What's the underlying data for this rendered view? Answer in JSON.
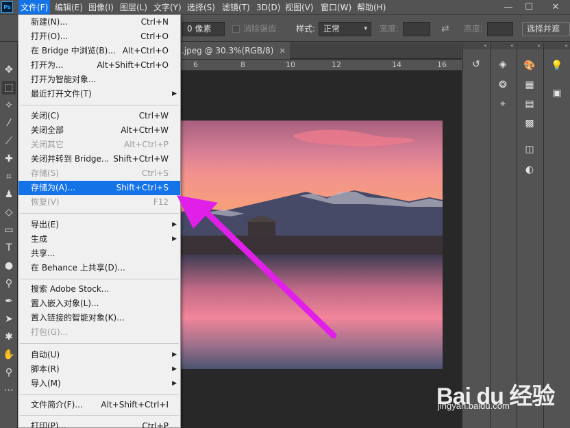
{
  "menubar": {
    "logo": "Ps",
    "items": [
      "文件(F)",
      "编辑(E)",
      "图像(I)",
      "图层(L)",
      "文字(Y)",
      "选择(S)",
      "滤镜(T)",
      "3D(D)",
      "视图(V)",
      "窗口(W)",
      "帮助(H)"
    ],
    "minimize": "—",
    "maximize": "☐",
    "close": "✕"
  },
  "options": {
    "feather": "0 像素",
    "antialias": "消除锯齿",
    "style_label": "样式:",
    "style_value": "正常",
    "width_label": "宽度:",
    "height_label": "高度:",
    "select_mask": "选择并遮"
  },
  "document": {
    "tab_title": ".jpeg @ 30.3%(RGB/8)",
    "tab_close": "✕",
    "ruler": [
      "6",
      "8",
      "10",
      "12",
      "14",
      "16"
    ]
  },
  "file_menu": {
    "items": [
      {
        "label": "新建(N)...",
        "shortcut": "Ctrl+N"
      },
      {
        "label": "打开(O)...",
        "shortcut": "Ctrl+O"
      },
      {
        "label": "在 Bridge 中浏览(B)...",
        "shortcut": "Alt+Ctrl+O"
      },
      {
        "label": "打开为...",
        "shortcut": "Alt+Shift+Ctrl+O"
      },
      {
        "label": "打开为智能对象...",
        "shortcut": ""
      },
      {
        "label": "最近打开文件(T)",
        "shortcut": ""
      },
      {
        "label": "关闭(C)",
        "shortcut": "Ctrl+W"
      },
      {
        "label": "关闭全部",
        "shortcut": "Alt+Ctrl+W"
      },
      {
        "label": "关闭其它",
        "shortcut": "Alt+Ctrl+P"
      },
      {
        "label": "关闭并转到 Bridge...",
        "shortcut": "Shift+Ctrl+W"
      },
      {
        "label": "存储(S)",
        "shortcut": "Ctrl+S"
      },
      {
        "label": "存储为(A)...",
        "shortcut": "Shift+Ctrl+S"
      },
      {
        "label": "恢复(V)",
        "shortcut": "F12"
      },
      {
        "label": "导出(E)",
        "shortcut": ""
      },
      {
        "label": "生成",
        "shortcut": ""
      },
      {
        "label": "共享...",
        "shortcut": ""
      },
      {
        "label": "在 Behance 上共享(D)...",
        "shortcut": ""
      },
      {
        "label": "搜索 Adobe Stock...",
        "shortcut": ""
      },
      {
        "label": "置入嵌入对象(L)...",
        "shortcut": ""
      },
      {
        "label": "置入链接的智能对象(K)...",
        "shortcut": ""
      },
      {
        "label": "打包(G)...",
        "shortcut": ""
      },
      {
        "label": "自动(U)",
        "shortcut": ""
      },
      {
        "label": "脚本(R)",
        "shortcut": ""
      },
      {
        "label": "导入(M)",
        "shortcut": ""
      },
      {
        "label": "文件简介(F)...",
        "shortcut": "Alt+Shift+Ctrl+I"
      },
      {
        "label": "打印(P)...",
        "shortcut": "Ctrl+P"
      }
    ]
  },
  "watermark": {
    "logo": "Bai du 经验",
    "url": "jingyan.baidu.com"
  },
  "colors": {
    "highlight": "#1473e6",
    "arrow": "#e020e8",
    "ui_bg": "#535353"
  }
}
